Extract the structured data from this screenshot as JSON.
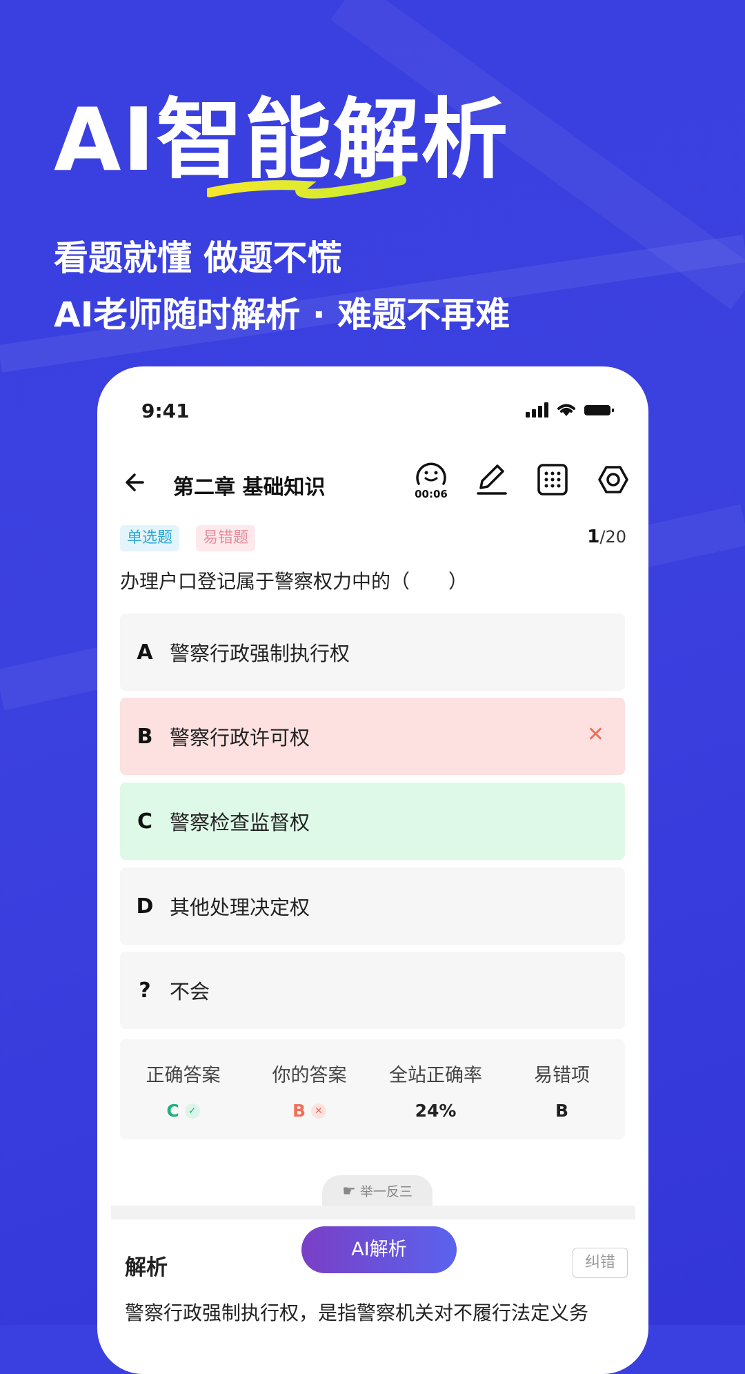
{
  "hero": {
    "title": "AI智能解析",
    "subtitle1": "看题就懂 做题不慌",
    "subtitle2": "AI老师随时解析 · 难题不再难"
  },
  "status_bar": {
    "time": "9:41"
  },
  "nav": {
    "title": "第二章 基础知识",
    "timer": "00:06"
  },
  "question": {
    "tags": [
      "单选题",
      "易错题"
    ],
    "current": "1",
    "total": "/20",
    "text": "办理户口登记属于警察权力中的（　　）",
    "options": [
      {
        "letter": "A",
        "text": "警察行政强制执行权",
        "state": "normal"
      },
      {
        "letter": "B",
        "text": "警察行政许可权",
        "state": "wrong",
        "mark": "✕"
      },
      {
        "letter": "C",
        "text": "警察检查监督权",
        "state": "correct"
      },
      {
        "letter": "D",
        "text": "其他处理决定权",
        "state": "normal"
      },
      {
        "letter": "?",
        "text": "不会",
        "state": "normal"
      }
    ]
  },
  "stats": {
    "correct_label": "正确答案",
    "correct_value": "C",
    "yours_label": "你的答案",
    "yours_value": "B",
    "rate_label": "全站正确率",
    "rate_value": "24%",
    "common_label": "易错项",
    "common_value": "B"
  },
  "tabs": {
    "example_label": "举一反三"
  },
  "ai_button": "AI解析",
  "analysis": {
    "title": "解析",
    "report": "纠错",
    "text": "警察行政强制执行权，是指警察机关对不履行法定义务"
  },
  "colors": {
    "background": "#3a3fe0",
    "correct": "#22b07a",
    "wrong": "#f0705a"
  }
}
